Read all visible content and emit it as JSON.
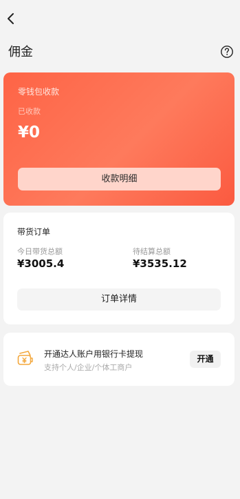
{
  "header": {
    "title": "佣金"
  },
  "wallet": {
    "title": "零钱包收款",
    "received_label": "已收款",
    "amount": "¥0",
    "details_button": "收款明细"
  },
  "orders": {
    "title": "带货订单",
    "today_total_label": "今日带货总额",
    "today_total_value": "¥3005.4",
    "pending_total_label": "待结算总额",
    "pending_total_value": "¥3535.12",
    "details_button": "订单详情"
  },
  "withdraw": {
    "title": "开通达人账户用银行卡提现",
    "subtitle": "支持个人/企业/个体工商户",
    "open_button": "开通",
    "icon": "wallet-yuan-icon"
  },
  "colors": {
    "accent": "#fe6446",
    "background": "#f3f3f3",
    "icon_orange": "#f3a73b"
  }
}
